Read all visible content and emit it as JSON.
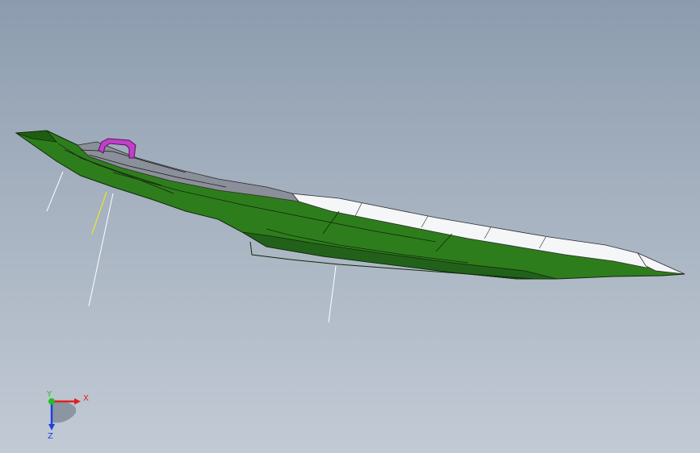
{
  "viewport": {
    "background_top": "#8c9cae",
    "background_bottom": "#c2cad5"
  },
  "model": {
    "part": "hull-assembly",
    "colors": {
      "hull": "#2e7d1c",
      "hull_dark": "#1f5e12",
      "deck_white": "#f4f6f8",
      "handle": "#c040c8",
      "edge": "#0f2a08",
      "deck_grey": "#8a8f99"
    }
  },
  "triad": {
    "x_label": "X",
    "y_label": "Y",
    "z_label": "Z",
    "x_color": "#e02020",
    "y_color": "#20c020",
    "z_color": "#2040e0"
  }
}
